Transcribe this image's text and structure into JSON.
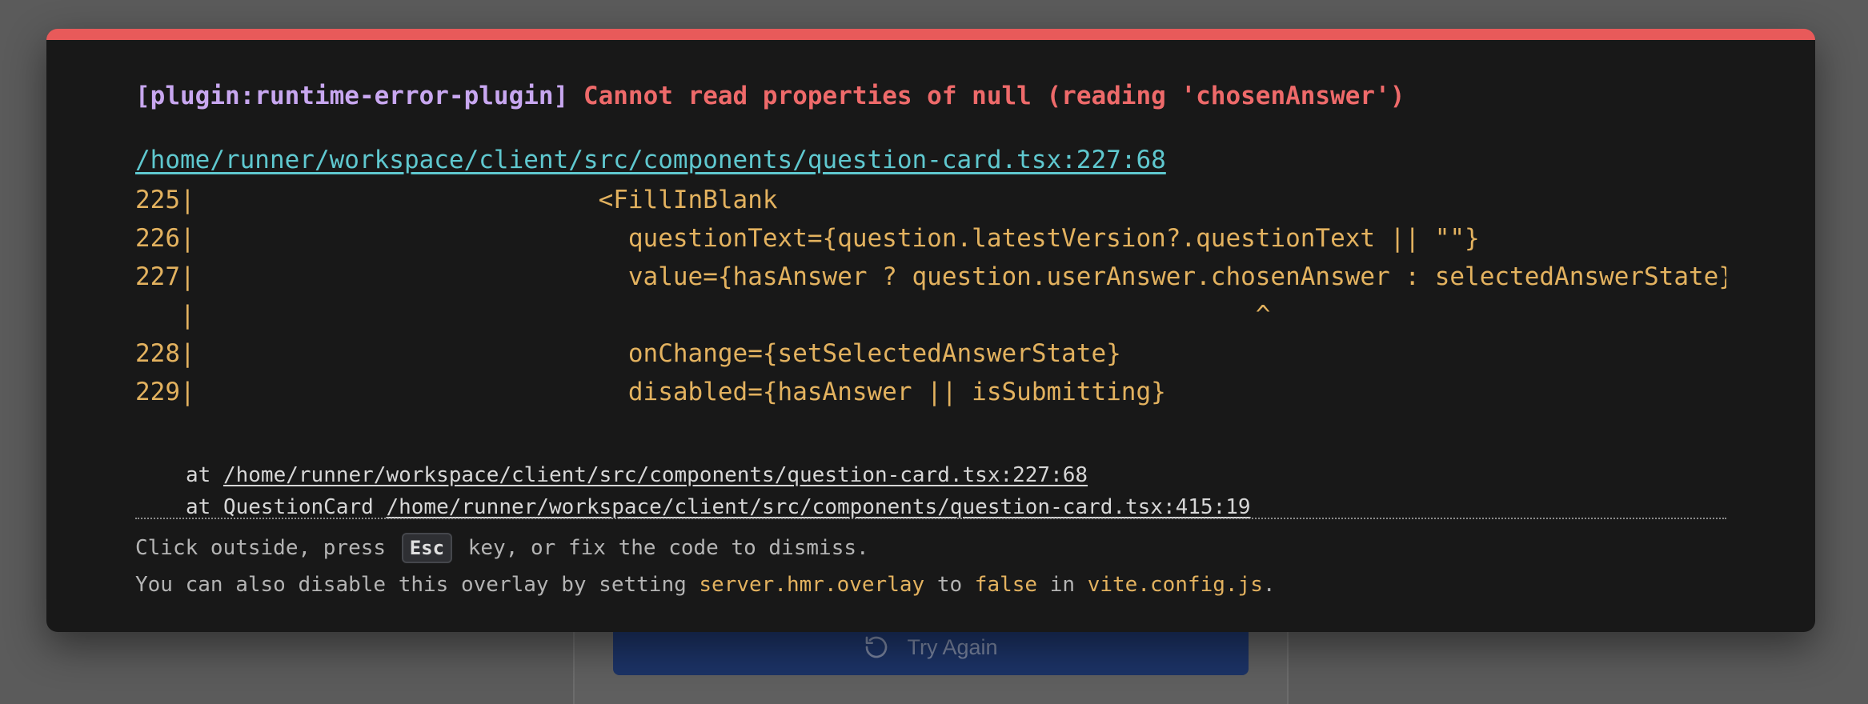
{
  "background_app": {
    "retry_button_label": "Try Again",
    "retry_icon": "rotate-ccw-icon"
  },
  "overlay": {
    "accent_color": "#e85a5a",
    "plugin": "[plugin:runtime-error-plugin]",
    "message": "Cannot read properties of null (reading 'chosenAnswer')",
    "file": "/home/runner/workspace/client/src/components/question-card.tsx:227:68",
    "code_frame": [
      "225|                           <FillInBlank",
      "226|                             questionText={question.latestVersion?.questionText || \"\"}",
      "227|                             value={hasAnswer ? question.userAnswer.chosenAnswer : selectedAnswerState}",
      "   |                                                                       ^",
      "228|                             onChange={setSelectedAnswerState}",
      "229|                             disabled={hasAnswer || isSubmitting}"
    ],
    "stack": [
      {
        "prefix": "at ",
        "link": "/home/runner/workspace/client/src/components/question-card.tsx:227:68"
      },
      {
        "prefix": "at QuestionCard ",
        "link": "/home/runner/workspace/client/src/components/question-card.tsx:415:19"
      }
    ],
    "tip": {
      "line1_before": "Click outside, press ",
      "key": "Esc",
      "line1_after": " key, or fix the code to dismiss.",
      "line2_a": "You can also disable this overlay by setting ",
      "line2_code1": "server.hmr.overlay",
      "line2_b": " to ",
      "line2_code2": "false",
      "line2_c": " in ",
      "line2_code3": "vite.config.js",
      "line2_d": "."
    }
  }
}
